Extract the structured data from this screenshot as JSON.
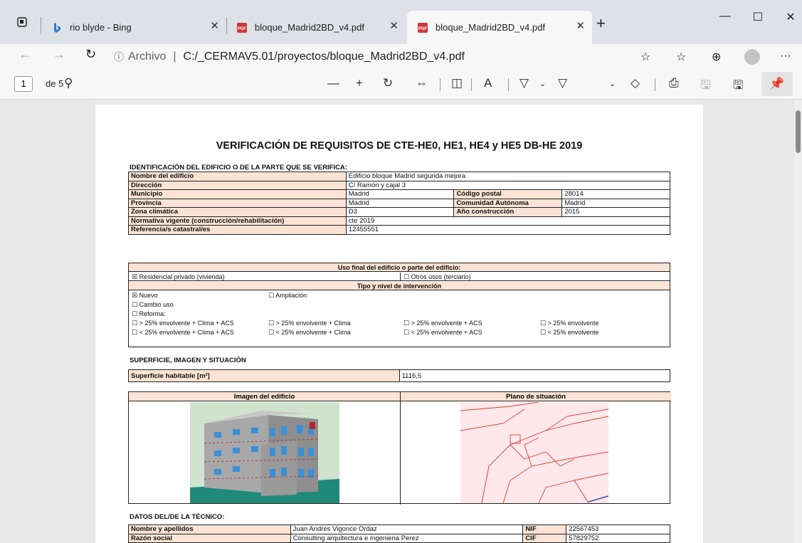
{
  "browser": {
    "tabs": [
      {
        "label": "rio blyde - Bing",
        "icon": "bing-icon",
        "active": false
      },
      {
        "label": "bloque_Madrid2BD_v4.pdf",
        "icon": "pdf-icon",
        "active": false
      },
      {
        "label": "bloque_Madrid2BD_v4.pdf",
        "icon": "pdf-icon",
        "active": true
      }
    ],
    "address": {
      "prefix": "Archivo",
      "separator": "|",
      "path": "C:/_CERMAV5.01/proyectos/bloque_Madrid2BD_v4.pdf"
    }
  },
  "pdf_toolbar": {
    "page_current": "1",
    "page_total": "de 5"
  },
  "document": {
    "title": "VERIFICACIÓN DE REQUISITOS DE CTE-HE0, HE1, HE4 y HE5 DB-HE 2019",
    "id_section": "IDENTIFICACIÓN DEL EDIFICIO O DE LA PARTE QUE SE VERIFICA:",
    "id_rows": {
      "nombre_label": "Nombre del edificio",
      "nombre_value": "Edificio bloque Madrid segunda mejora",
      "direccion_label": "Dirección",
      "direccion_value": "C/ Ramón y cajal 3",
      "municipio_label": "Municipio",
      "municipio_value": "Madrid",
      "cp_label": "Código postal",
      "cp_value": "28014",
      "provincia_label": "Provincia",
      "provincia_value": "Madrid",
      "ca_label": "Comunidad Autónoma",
      "ca_value": "Madrid",
      "zona_label": "Zona climática",
      "zona_value": "D3",
      "anio_label": "Año construcción",
      "anio_value": "2015",
      "normativa_label": "Normativa vigente (construcción/rehabilitación)",
      "normativa_value": "cte 2019",
      "catastral_label": "Referencia/s catastral/es",
      "catastral_value": "12455551"
    },
    "uso": {
      "header": "Uso final del edificio o parte del edificio:",
      "residencial": "Residencial privado (vivienda)",
      "otros": "Otros usos (terciario)",
      "tipo_header": "Tipo y nivel de intervención",
      "nuevo": "Nuevo",
      "ampliacion": "Ampliación",
      "cambio": "Cambio uso",
      "reforma": "Reforma:",
      "r1": "> 25% envolvente + Clima + ACS",
      "r2": "> 25% envolvente + Clima",
      "r3": "> 25% envolvente + ACS",
      "r4": "> 25% envolvente",
      "r5": "< 25% envolvente + Clima + ACS",
      "r6": "< 25% envolvente + Clima",
      "r7": "< 25% envolvente + ACS",
      "r8": "< 25% envolvente",
      "checked_mark": "☒",
      "unchecked_mark": "☐"
    },
    "superficie_section": "SUPERFICIE, IMAGEN Y SITUACIÓN",
    "superficie_label": "Superficie habitable [m²]",
    "superficie_value": "1116,5",
    "imagen_header": "Imagen del edificio",
    "plano_header": "Plano de situación",
    "tecnico_section": "DATOS DEL/DE LA TÉCNICO:",
    "tecnico": {
      "nombre_label": "Nombre y apellidos",
      "nombre_value": "Juan Andres Vigonce Ordaz",
      "nif_label": "NIF",
      "nif_value": "22567453",
      "razon_label": "Razón social",
      "razon_value": "Consulting arquitectura e ingenieria Perez",
      "cif_label": "CIF",
      "cif_value": "57829752"
    }
  }
}
